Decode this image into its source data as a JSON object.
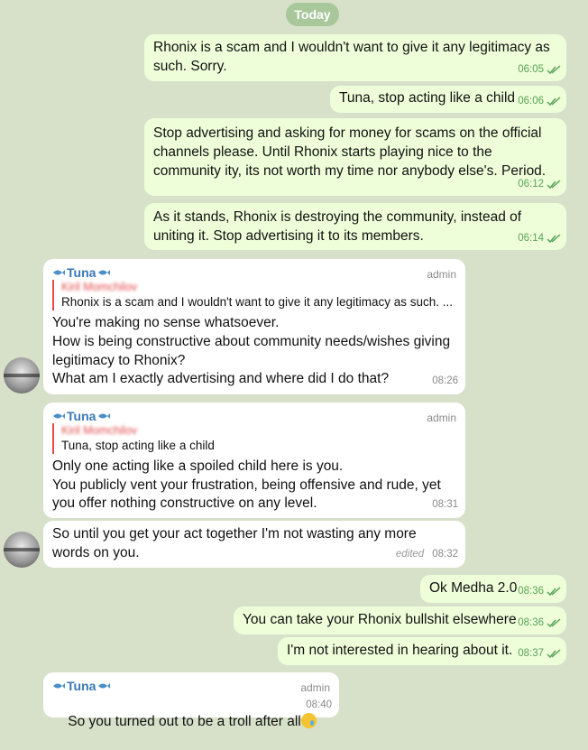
{
  "date_separator": "Today",
  "messages": [
    {
      "direction": "outgoing",
      "lines": [
        "Rhonix is a scam and I wouldn't want to give it any legitimacy as",
        "such. Sorry."
      ],
      "time": "06:05",
      "read": true
    },
    {
      "direction": "outgoing",
      "lines": [
        "Tuna, stop acting like a child"
      ],
      "time": "06:06",
      "read": true
    },
    {
      "direction": "outgoing",
      "lines": [
        "Stop advertising and asking for money for scams on the official",
        "channels please. Until Rhonix starts playing nice to the",
        "community ity, its not worth my time nor anybody else's. Period."
      ],
      "time": "06:12",
      "read": true
    },
    {
      "direction": "outgoing",
      "lines": [
        "As it stands, Rhonix is destroying the community, instead of",
        "uniting it. Stop advertising it to its members."
      ],
      "time": "06:14",
      "read": true
    },
    {
      "direction": "incoming",
      "sender": "Tuna",
      "role": "admin",
      "reply_to": {
        "name": "Kiril Momchilov",
        "text": "Rhonix is a scam and I wouldn't want to give it any legitimacy as such. ..."
      },
      "lines": [
        "You're making no sense whatsoever.",
        "How is being constructive about community needs/wishes giving",
        "legitimacy to Rhonix?",
        "What am I exactly advertising and where did I do that?"
      ],
      "time": "08:26"
    },
    {
      "direction": "incoming",
      "sender": "Tuna",
      "role": "admin",
      "reply_to": {
        "name": "Kiril Momchilov",
        "text": "Tuna, stop acting like a child"
      },
      "lines": [
        "Only one acting like a spoiled child here is you.",
        "You publicly vent your frustration, being offensive and rude, yet",
        "you offer nothing constructive on any level."
      ],
      "time": "08:31"
    },
    {
      "direction": "incoming",
      "lines": [
        "So until you get your act together I'm not wasting any more",
        "words on you."
      ],
      "edited_label": "edited",
      "time": "08:32"
    },
    {
      "direction": "outgoing",
      "lines": [
        "Ok Medha 2.0"
      ],
      "time": "08:36",
      "read": true
    },
    {
      "direction": "outgoing",
      "lines": [
        "You can take your Rhonix bullshit elsewhere"
      ],
      "time": "08:36",
      "read": true
    },
    {
      "direction": "outgoing",
      "lines": [
        "I'm not interested in hearing about it."
      ],
      "time": "08:37",
      "read": true
    },
    {
      "direction": "incoming",
      "sender": "Tuna",
      "role": "admin",
      "lines": [
        "So you turned out to be a troll after all"
      ],
      "emoji": "sad-face-with-tear",
      "time": "08:40"
    }
  ],
  "colors": {
    "background": "#d7e1c9",
    "outgoing_bubble": "#eefed9",
    "incoming_bubble": "#ffffff",
    "sender_name": "#3a78b5",
    "reply_accent": "#e34b4b",
    "read_check": "#5aa35a"
  }
}
